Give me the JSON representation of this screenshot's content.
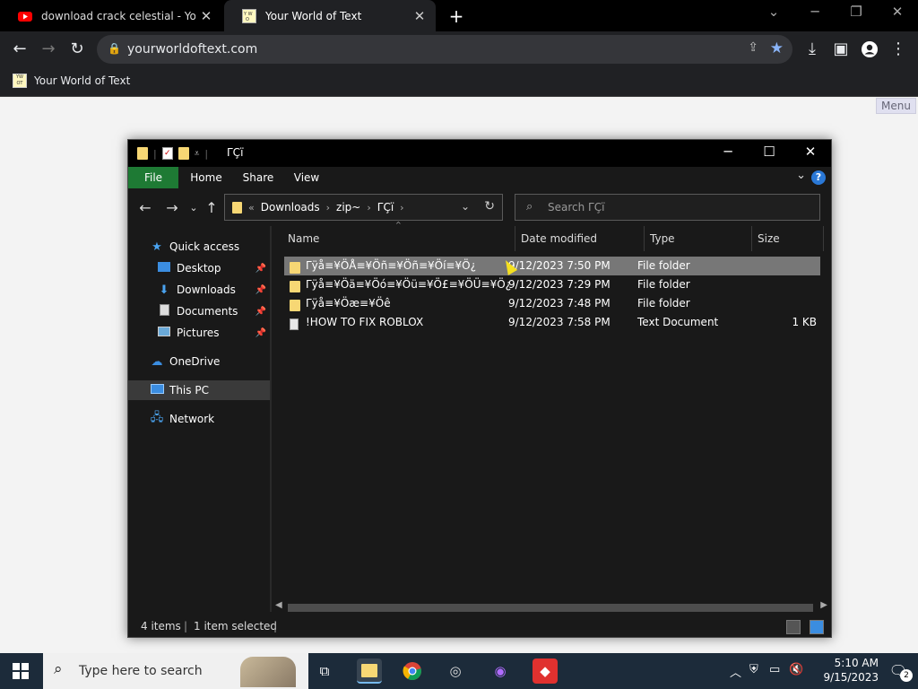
{
  "browser": {
    "tabs": [
      {
        "title": "download crack celestial - YouTube",
        "favicon": "youtube-icon"
      },
      {
        "title": "Your World of Text",
        "favicon": "yourworldoftext-icon"
      }
    ],
    "new_tab": "+",
    "url": "yourworldoftext.com",
    "bookmark": "Your World of Text",
    "page_menu": "Menu"
  },
  "explorer": {
    "title": "ΓÇï",
    "ribbon_tabs": [
      "File",
      "Home",
      "Share",
      "View"
    ],
    "breadcrumb": [
      "«",
      "Downloads",
      "zip~",
      "ΓÇï"
    ],
    "search_placeholder": "Search ΓÇï",
    "nav_pane": [
      {
        "label": "Quick access",
        "icon": "star-icon"
      },
      {
        "label": "Desktop",
        "icon": "desktop-icon",
        "pinned": true
      },
      {
        "label": "Downloads",
        "icon": "download-icon",
        "pinned": true
      },
      {
        "label": "Documents",
        "icon": "documents-icon",
        "pinned": true
      },
      {
        "label": "Pictures",
        "icon": "pictures-icon",
        "pinned": true
      },
      {
        "label": "OneDrive",
        "icon": "cloud-icon"
      },
      {
        "label": "This PC",
        "icon": "computer-icon"
      },
      {
        "label": "Network",
        "icon": "network-icon"
      }
    ],
    "columns": [
      "Name",
      "Date modified",
      "Type",
      "Size"
    ],
    "files": [
      {
        "name": "Γÿå≡¥ÖÅ≡¥Öñ≡¥Öñ≡¥Öí≡¥Ö¿",
        "date": "9/12/2023 7:50 PM",
        "type": "File folder",
        "size": "",
        "kind": "folder"
      },
      {
        "name": "Γÿå≡¥Öä≡¥Öó≡¥Öü≡¥Ö£≡¥ÖÜ≡¥Ö¿",
        "date": "9/12/2023 7:29 PM",
        "type": "File folder",
        "size": "",
        "kind": "folder"
      },
      {
        "name": "Γÿå≡¥Öæ≡¥Öê",
        "date": "9/12/2023 7:48 PM",
        "type": "File folder",
        "size": "",
        "kind": "folder"
      },
      {
        "name": "!HOW TO FIX ROBLOX",
        "date": "9/12/2023 7:58 PM",
        "type": "Text Document",
        "size": "1 KB",
        "kind": "text"
      }
    ],
    "status": {
      "items": "4 items",
      "selected": "1 item selected"
    }
  },
  "taskbar": {
    "search_placeholder": "Type here to search",
    "time": "5:10 AM",
    "date": "9/15/2023",
    "notification_count": "2"
  },
  "colors": {
    "file_tab": "#1e7a34",
    "selection": "#777777",
    "taskbar": "#1c2b3a"
  }
}
